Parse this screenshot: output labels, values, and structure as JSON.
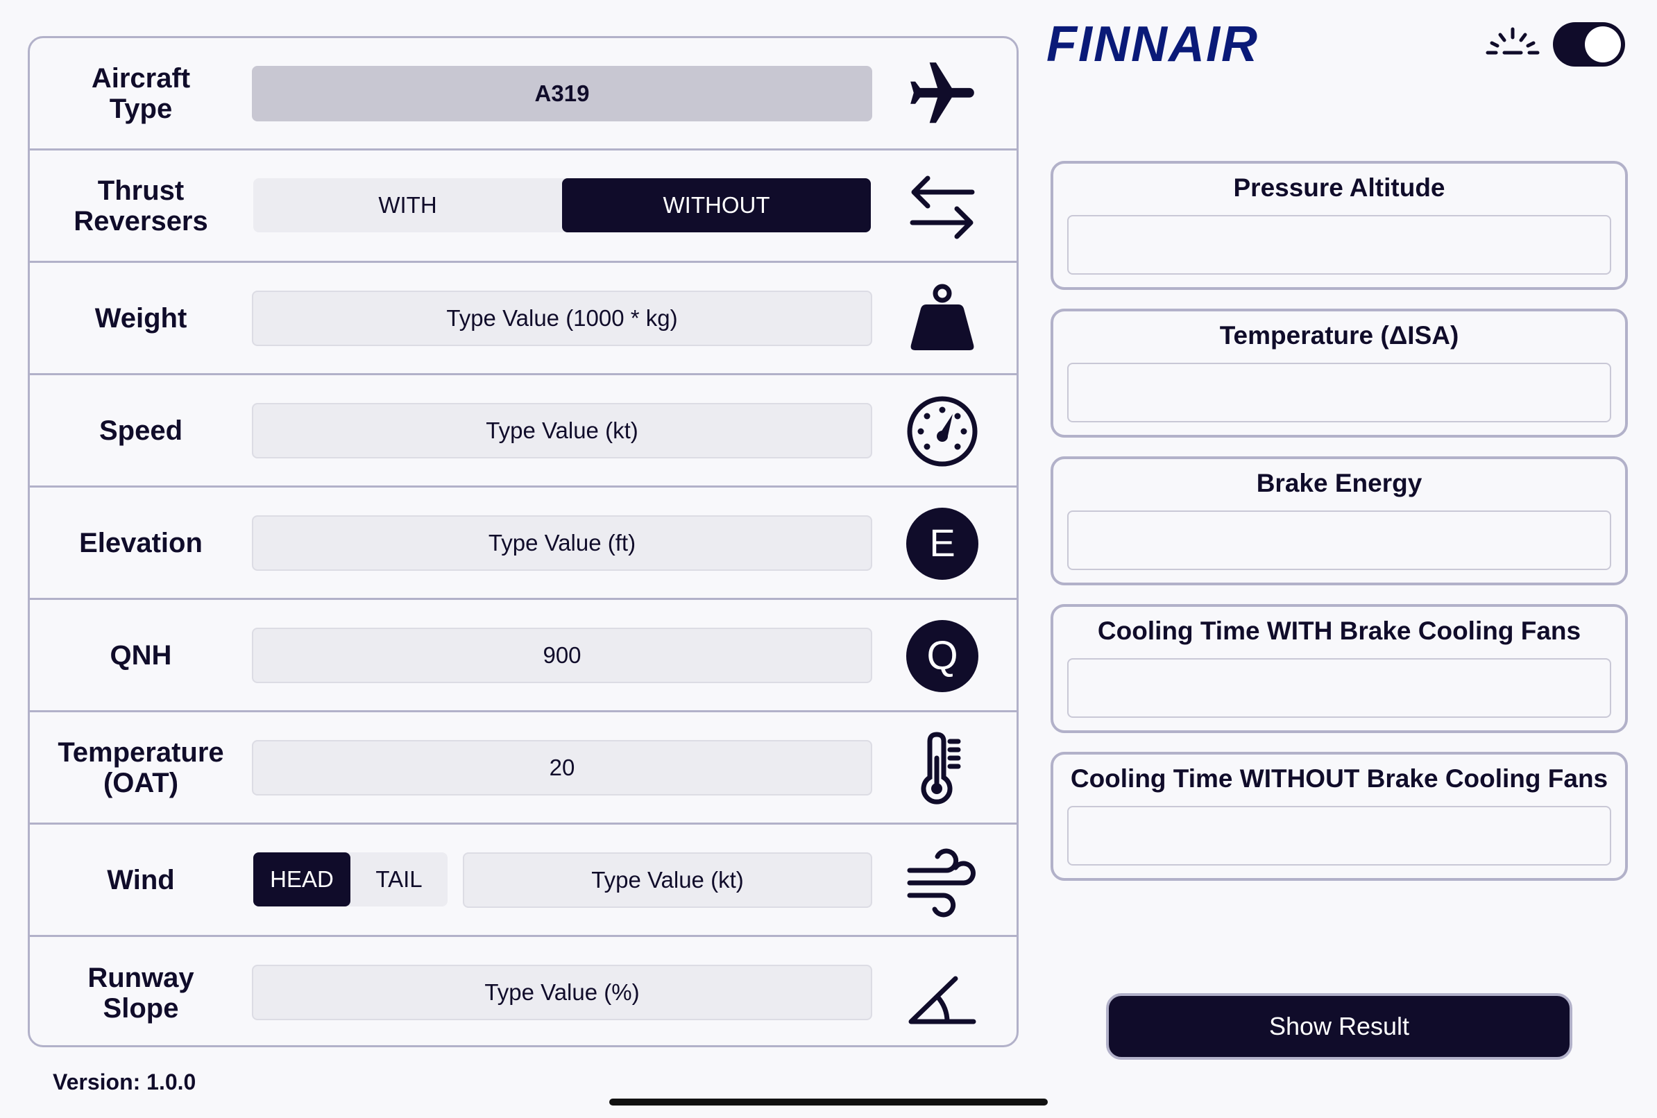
{
  "colors": {
    "primary": "#100c2a",
    "border": "#b2b1c9",
    "field": "#ececf1",
    "field_disabled": "#c8c7d2"
  },
  "brand": {
    "logo_text": "FINNAIR"
  },
  "form": {
    "aircraft": {
      "label": "Aircraft\nType",
      "value": "A319",
      "icon": "airplane-icon"
    },
    "thrust": {
      "label": "Thrust\nReversers",
      "options": [
        "WITH",
        "WITHOUT"
      ],
      "selected": "WITHOUT",
      "icon": "arrows-left-right-icon"
    },
    "weight": {
      "label": "Weight",
      "placeholder": "Type Value (1000 * kg)",
      "icon": "weight-icon"
    },
    "speed": {
      "label": "Speed",
      "placeholder": "Type Value (kt)",
      "icon": "speedometer-icon"
    },
    "elevation": {
      "label": "Elevation",
      "placeholder": "Type Value (ft)",
      "icon": "letter-e-icon",
      "icon_letter": "E"
    },
    "qnh": {
      "label": "QNH",
      "value": "900",
      "icon": "letter-q-icon",
      "icon_letter": "Q"
    },
    "temperature": {
      "label": "Temperature\n(OAT)",
      "value": "20",
      "icon": "thermometer-icon"
    },
    "wind": {
      "label": "Wind",
      "options": [
        "HEAD",
        "TAIL"
      ],
      "selected": "HEAD",
      "placeholder": "Type Value (kt)",
      "icon": "wind-icon"
    },
    "slope": {
      "label": "Runway\nSlope",
      "placeholder": "Type Value (%)",
      "icon": "angle-icon"
    }
  },
  "results": [
    {
      "title": "Pressure Altitude",
      "value": ""
    },
    {
      "title": "Temperature (ΔISA)",
      "value": ""
    },
    {
      "title": "Brake Energy",
      "value": ""
    },
    {
      "title": "Cooling Time WITH Brake Cooling Fans",
      "value": ""
    },
    {
      "title": "Cooling Time WITHOUT Brake Cooling Fans",
      "value": ""
    }
  ],
  "show_result_label": "Show Result",
  "version": "Version: 1.0.0",
  "theme_toggle": {
    "on": true
  }
}
